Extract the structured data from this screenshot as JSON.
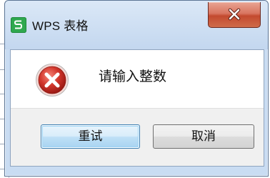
{
  "window": {
    "title": "WPS 表格",
    "app_icon": "wps-spreadsheet-icon",
    "close_icon": "close-icon"
  },
  "dialog": {
    "icon": "error-icon",
    "message": "请输入整数",
    "buttons": {
      "retry_label": "重试",
      "cancel_label": "取消"
    }
  },
  "colors": {
    "frame": "#c9dcf2",
    "close_button": "#c34a2f",
    "app_icon_green": "#2fa84f",
    "error_red": "#d1352b",
    "primary_button_border": "#3c7fb1"
  }
}
